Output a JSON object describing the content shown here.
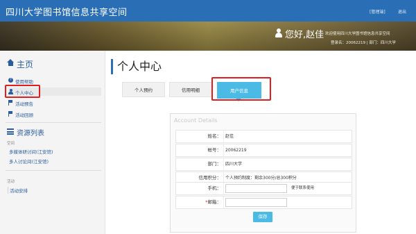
{
  "header": {
    "title": "四川大学图书馆信息共享空间",
    "admin_link": "[管理端]",
    "logout_link": "退出"
  },
  "banner": {
    "greeting": "您好,赵佳",
    "welcome_text": "欢迎使用四川大学图书馆信息共享空间",
    "login_info": "登录名：20062219 | 部门：四川大学"
  },
  "sidebar": {
    "home_title": "主页",
    "items": [
      {
        "label": "使用帮助",
        "icon": "help-icon"
      },
      {
        "label": "个人中心",
        "icon": "user-icon"
      },
      {
        "label": "活动预告",
        "icon": "flag-icon"
      },
      {
        "label": "活动回顾",
        "icon": "flag-icon"
      }
    ],
    "resource_title": "资源列表",
    "space_section": "空间",
    "space_links": [
      "多媒体研讨间(江安馆)",
      "多人讨论间(江安馆)"
    ],
    "activity_section": "活动",
    "activity_links": [
      "活动安排"
    ]
  },
  "main": {
    "page_title": "个人中心",
    "tabs": [
      {
        "label": "个人预约",
        "active": false
      },
      {
        "label": "信用明细",
        "active": false
      },
      {
        "label": "用户信息",
        "active": true
      }
    ]
  },
  "account": {
    "panel_title": "Account Details",
    "fields": [
      {
        "label": "姓名：",
        "value": "赵佳"
      },
      {
        "label": "帐号：",
        "value": "20062219"
      },
      {
        "label": "部门：",
        "value": "四川大学"
      },
      {
        "label": "信用积分：",
        "value": "个人预约制度：剩余300分/总300积分"
      }
    ],
    "phone_label": "手机：",
    "phone_value": "",
    "phone_hint": "便于联系使用",
    "email_required_mark": "*",
    "email_label": "邮箱：",
    "email_value": "",
    "save_label": "保存"
  },
  "colors": {
    "topbar": "#2a6fb5",
    "accent": "#4bbbe5",
    "highlight": "#e21d1d",
    "link": "#2a5d9f"
  }
}
